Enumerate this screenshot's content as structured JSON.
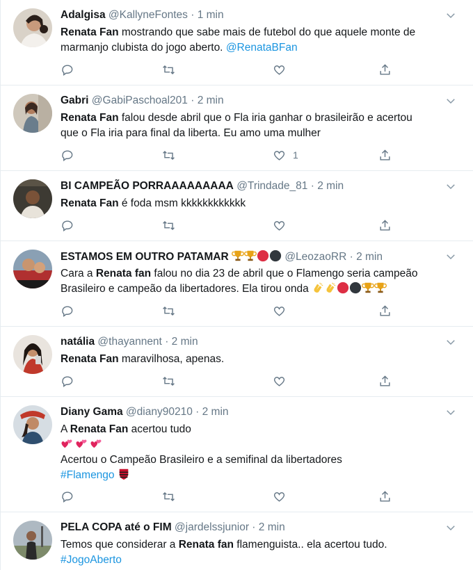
{
  "tweets": [
    {
      "name": "Adalgisa",
      "handle": "@KallyneFontes",
      "sep": "·",
      "time": "1 min",
      "lines": [
        {
          "pre": "",
          "bold": "Renata Fan",
          "post": " mostrando que sabe mais de futebol do que aquele monte de"
        },
        {
          "pre": "marmanjo clubista do jogo aberto. ",
          "link": "@RenataBFan"
        }
      ],
      "likes": ""
    },
    {
      "name": "Gabri",
      "handle": "@GabiPaschoal201",
      "sep": "·",
      "time": "2 min",
      "lines": [
        {
          "pre": "",
          "bold": "Renata Fan",
          "post": " falou desde abril que o Fla iria ganhar o brasileirão e acertou"
        },
        {
          "pre": "que o Fla iria para final da liberta. Eu amo uma mulher"
        }
      ],
      "likes": "1"
    },
    {
      "name": "BI CAMPEÃO PORRAAAAAAAAA",
      "handle": "@Trindade_81",
      "sep": "·",
      "time": "2 min",
      "lines": [
        {
          "pre": "",
          "bold": "Renata Fan",
          "post": " é foda msm kkkkkkkkkkkk"
        }
      ],
      "likes": ""
    },
    {
      "name": "ESTAMOS EM OUTRO PATAMAR",
      "handle": "@LeozaoRR",
      "sep": "·",
      "time": "2 min",
      "lines": [
        {
          "pre": "Cara a ",
          "bold": "Renata fan",
          "post": " falou no dia 23 de abril que o Flamengo seria campeão"
        },
        {
          "pre": "Brasileiro e campeão da libertadores. Ela tirou onda "
        }
      ],
      "likes": ""
    },
    {
      "name": "natália",
      "handle": "@thayannent",
      "sep": "·",
      "time": "2 min",
      "lines": [
        {
          "pre": "",
          "bold": "Renata Fan",
          "post": " maravilhosa, apenas."
        }
      ],
      "likes": ""
    },
    {
      "name": "Diany Gama",
      "handle": "@diany90210",
      "sep": "·",
      "time": "2 min",
      "lines": [
        {
          "pre": "A ",
          "bold": "Renata Fan",
          "post": " acertou tudo"
        },
        {
          "pre": ""
        },
        {
          "pre": "Acertou o Campeão Brasileiro e a semifinal da libertadores"
        },
        {
          "pre": "",
          "link": "#Flamengo"
        }
      ],
      "likes": ""
    },
    {
      "name": "PELA COPA até o FIM",
      "handle": "@jardelssjunior",
      "sep": "·",
      "time": "2 min",
      "lines": [
        {
          "pre": "Temos que considerar a ",
          "bold": "Renata fan",
          "post": " flamenguista.. ela acertou tudo."
        },
        {
          "pre": "",
          "link": "#JogoAberto"
        }
      ],
      "likes": ""
    }
  ],
  "colors": {
    "link": "#1b95e0",
    "muted": "#657786",
    "divider": "#e6ecf0"
  },
  "icons": {
    "reply": "reply-icon",
    "retweet": "retweet-icon",
    "like": "heart-icon",
    "share": "share-icon",
    "caret": "chevron-down-icon"
  }
}
